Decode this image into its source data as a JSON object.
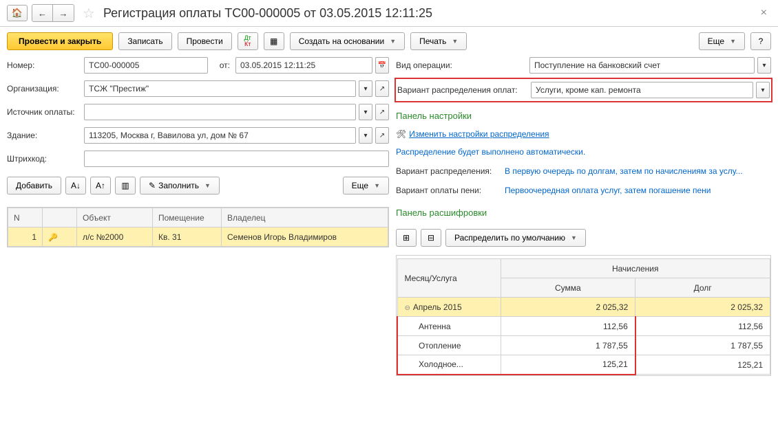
{
  "title": "Регистрация оплаты ТС00-000005 от 03.05.2015 12:11:25",
  "toolbar": {
    "post_close": "Провести и закрыть",
    "save": "Записать",
    "post": "Провести",
    "create_based": "Создать на основании",
    "print": "Печать",
    "more": "Еще",
    "help": "?"
  },
  "form": {
    "number_label": "Номер:",
    "number": "ТС00-000005",
    "from_label": "от:",
    "date": "03.05.2015 12:11:25",
    "org_label": "Организация:",
    "org": "ТСЖ \"Престиж\"",
    "source_label": "Источник оплаты:",
    "source": "",
    "building_label": "Здание:",
    "building": "113205, Москва г, Вавилова ул, дом № 67",
    "barcode_label": "Штрихкод:",
    "barcode": "",
    "optype_label": "Вид операции:",
    "optype": "Поступление на банковский счет",
    "dist_label": "Вариант распределения оплат:",
    "dist": "Услуги, кроме кап. ремонта"
  },
  "left_toolbar": {
    "add": "Добавить",
    "fill": "Заполнить",
    "more": "Еще"
  },
  "left_table": {
    "headers": {
      "n": "N",
      "icon": "",
      "object": "Объект",
      "room": "Помещение",
      "owner": "Владелец"
    },
    "rows": [
      {
        "n": "1",
        "object": "л/с №2000",
        "room": "Кв. 31",
        "owner": "Семенов Игорь Владимиров"
      }
    ]
  },
  "settings": {
    "panel_title": "Панель настройки",
    "change_link": "Изменить настройки распределения",
    "auto_text": "Распределение будет выполнено автоматически.",
    "dist_var_label": "Вариант распределения:",
    "dist_var_value": "В первую очередь по долгам, затем по начислениям за услу...",
    "penalty_label": "Вариант оплаты пени:",
    "penalty_value": "Первоочередная оплата услуг, затем погашение пени"
  },
  "detail": {
    "panel_title": "Панель расшифровки",
    "distribute_btn": "Распределить по умолчанию",
    "headers": {
      "month": "Месяц/Услуга",
      "charges": "Начисления",
      "sum": "Сумма",
      "debt": "Долг"
    },
    "month_row": {
      "label": "Апрель 2015",
      "sum": "2 025,32",
      "debt": "2 025,32"
    },
    "rows": [
      {
        "label": "Антенна",
        "sum": "112,56",
        "debt": "112,56"
      },
      {
        "label": "Отопление",
        "sum": "1 787,55",
        "debt": "1 787,55"
      },
      {
        "label": "Холодное...",
        "sum": "125,21",
        "debt": "125,21"
      }
    ]
  }
}
